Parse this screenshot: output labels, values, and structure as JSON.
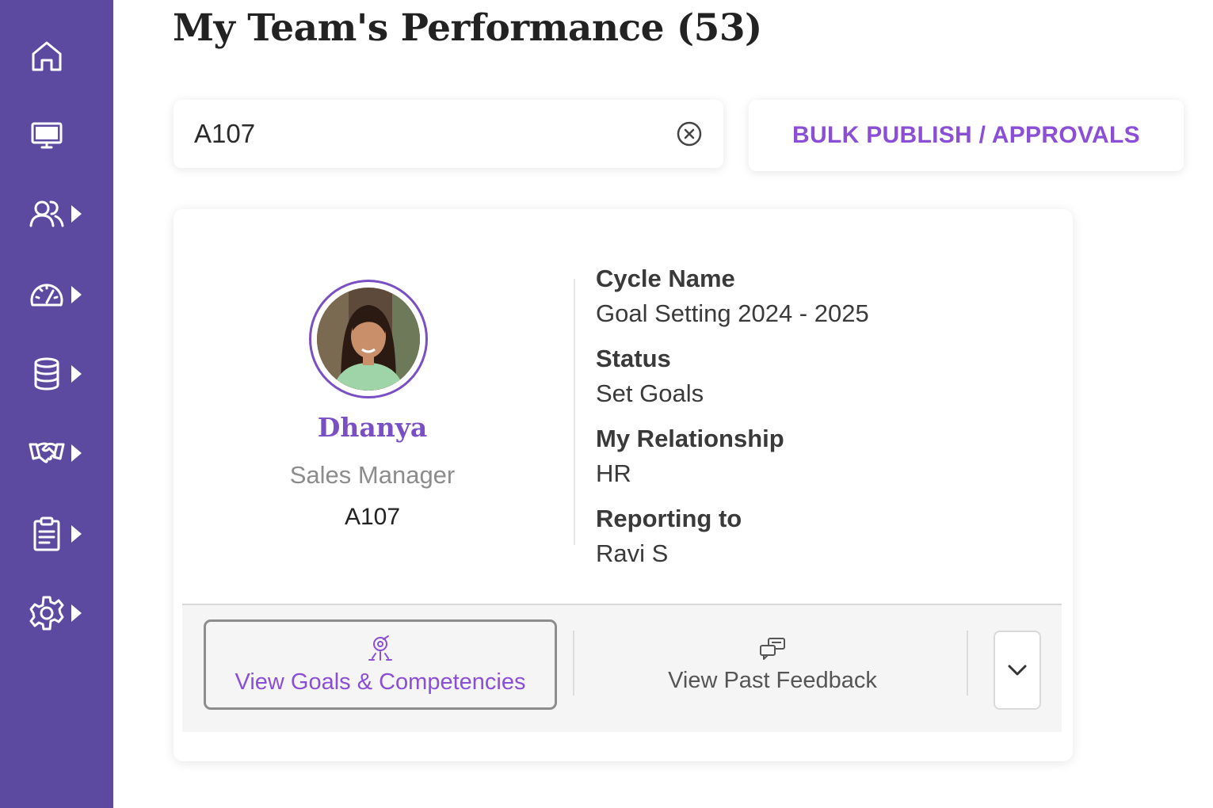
{
  "page": {
    "title": "My Team's Performance (53)"
  },
  "search": {
    "value": "A107",
    "placeholder": ""
  },
  "actions": {
    "bulk_label": "BULK PUBLISH / APPROVALS"
  },
  "sidebar": {
    "items": [
      {
        "icon": "home-icon",
        "has_submenu": false
      },
      {
        "icon": "monitor-icon",
        "has_submenu": false
      },
      {
        "icon": "users-icon",
        "has_submenu": true
      },
      {
        "icon": "gauge-icon",
        "has_submenu": true
      },
      {
        "icon": "database-icon",
        "has_submenu": true
      },
      {
        "icon": "handshake-icon",
        "has_submenu": true
      },
      {
        "icon": "clipboard-icon",
        "has_submenu": true
      },
      {
        "icon": "gear-icon",
        "has_submenu": true
      }
    ]
  },
  "employee": {
    "name": "Dhanya",
    "role": "Sales Manager",
    "id": "A107",
    "fields": [
      {
        "label": "Cycle Name",
        "value": "Goal Setting 2024 - 2025"
      },
      {
        "label": "Status",
        "value": "Set Goals"
      },
      {
        "label": "My Relationship",
        "value": "HR"
      },
      {
        "label": "Reporting to",
        "value": "Ravi S"
      }
    ]
  },
  "card_actions": {
    "goals_label": "View Goals & Competencies",
    "feedback_label": "View Past Feedback"
  },
  "colors": {
    "sidebar": "#5b4aa0",
    "accent": "#8a4fd6"
  }
}
